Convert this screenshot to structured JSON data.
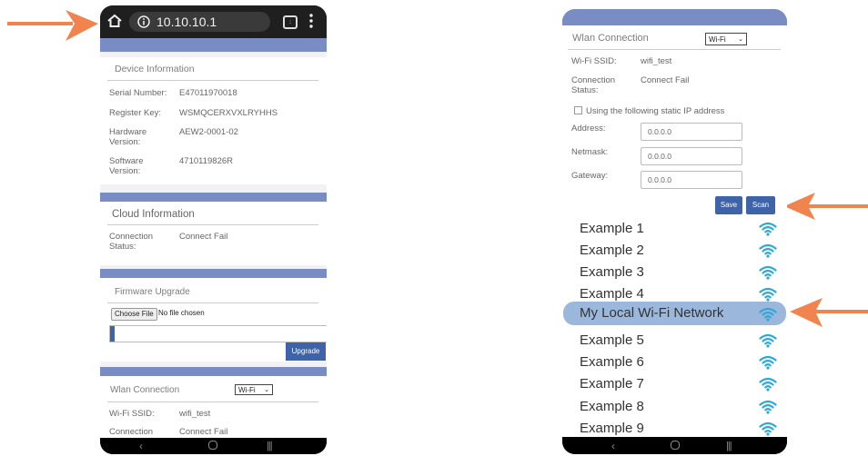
{
  "colors": {
    "arrow": "#f0834e",
    "band": "#7a8cc4",
    "button_blue": "#3f63a8",
    "wifi_icon": "#2ea8d8",
    "selected_row": "#9cb7dc"
  },
  "left_phone": {
    "browser": {
      "url": "10.10.10.1",
      "icons": [
        "home-icon",
        "info-icon",
        "tabs-icon",
        "menu-icon"
      ]
    },
    "device_info": {
      "title": "Device Information",
      "rows": [
        {
          "label": "Serial Number:",
          "value": "E47011970018"
        },
        {
          "label": "Register Key:",
          "value": "WSMQCERXVXLRYHHS"
        },
        {
          "label": "Hardware Version:",
          "value": "AEW2-0001-02"
        },
        {
          "label": "Software Version:",
          "value": "4710119826R"
        }
      ]
    },
    "cloud_info": {
      "title": "Cloud Information",
      "status_label": "Connection Status:",
      "status_value": "Connect Fail"
    },
    "firmware": {
      "title": "Firmware Upgrade",
      "choose_label": "Choose File",
      "no_file": "No file chosen",
      "progress": 0.02,
      "upgrade_label": "Upgrade"
    },
    "wlan": {
      "title": "Wlan Connection",
      "mode": "Wi-Fi",
      "ssid_label": "Wi-Fi SSID:",
      "ssid_value": "wifi_test",
      "status_label": "Connection",
      "status_value": "Connect Fail"
    },
    "nav": [
      "back-icon",
      "home-nav-icon",
      "recents-icon"
    ]
  },
  "right_phone": {
    "wlan": {
      "title": "Wlan Connection",
      "mode": "Wi-Fi",
      "ssid_label": "Wi-Fi SSID:",
      "ssid_value": "wifi_test",
      "status_label": "Connection Status:",
      "status_value": "Connect Fail",
      "static_ip_label": "Using the following static IP address",
      "static_ip_checked": false,
      "address_label": "Address:",
      "address_value": "0.0.0.0",
      "netmask_label": "Netmask:",
      "netmask_value": "0.0.0.0",
      "gateway_label": "Gateway:",
      "gateway_value": "0.0.0.0",
      "save_label": "Save",
      "scan_label": "Scan"
    },
    "networks": [
      {
        "name": "Example 1",
        "selected": false
      },
      {
        "name": "Example 2",
        "selected": false
      },
      {
        "name": "Example 3",
        "selected": false
      },
      {
        "name": "Example 4",
        "selected": false
      },
      {
        "name": "My Local Wi-Fi Network",
        "selected": true
      },
      {
        "name": "Example 5",
        "selected": false
      },
      {
        "name": "Example 6",
        "selected": false
      },
      {
        "name": "Example 7",
        "selected": false
      },
      {
        "name": "Example 8",
        "selected": false
      },
      {
        "name": "Example 9",
        "selected": false
      }
    ],
    "nav": [
      "back-icon",
      "home-nav-icon",
      "recents-icon"
    ]
  }
}
